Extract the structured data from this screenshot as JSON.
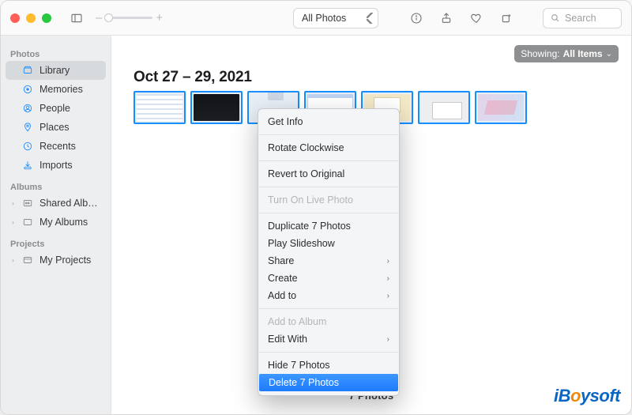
{
  "toolbar": {
    "view_popup": "All Photos",
    "search_placeholder": "Search"
  },
  "sidebar": {
    "sections": [
      {
        "title": "Photos",
        "items": [
          {
            "icon": "library",
            "label": "Library",
            "active": true
          },
          {
            "icon": "memories",
            "label": "Memories"
          },
          {
            "icon": "people",
            "label": "People"
          },
          {
            "icon": "places",
            "label": "Places"
          },
          {
            "icon": "recents",
            "label": "Recents"
          },
          {
            "icon": "imports",
            "label": "Imports"
          }
        ]
      },
      {
        "title": "Albums",
        "items": [
          {
            "chevron": true,
            "icon": "shared",
            "label": "Shared Alb…"
          },
          {
            "chevron": true,
            "icon": "album",
            "label": "My Albums"
          }
        ]
      },
      {
        "title": "Projects",
        "items": [
          {
            "chevron": true,
            "icon": "projects",
            "label": "My Projects"
          }
        ]
      }
    ]
  },
  "main": {
    "date_header": "Oct 27 – 29, 2021",
    "showing_label": "Showing:",
    "showing_value": "All Items",
    "thumbnail_count": 7,
    "footer_count": "7 Photos"
  },
  "context_menu": {
    "items": [
      {
        "label": "Get Info",
        "highlight": false
      },
      {
        "sep": true
      },
      {
        "label": "Rotate Clockwise"
      },
      {
        "sep": true
      },
      {
        "label": "Revert to Original"
      },
      {
        "sep": true
      },
      {
        "label": "Turn On Live Photo",
        "disabled": true
      },
      {
        "sep": true
      },
      {
        "label": "Duplicate 7 Photos"
      },
      {
        "label": "Play Slideshow"
      },
      {
        "label": "Share",
        "submenu": true
      },
      {
        "label": "Create",
        "submenu": true
      },
      {
        "label": "Add to",
        "submenu": true
      },
      {
        "sep": true
      },
      {
        "label": "Add to Album",
        "disabled": true
      },
      {
        "label": "Edit With",
        "submenu": true
      },
      {
        "sep": true
      },
      {
        "label": "Hide 7 Photos"
      },
      {
        "label": "Delete 7 Photos",
        "highlight": true
      }
    ]
  },
  "watermark": "iBoysoft"
}
